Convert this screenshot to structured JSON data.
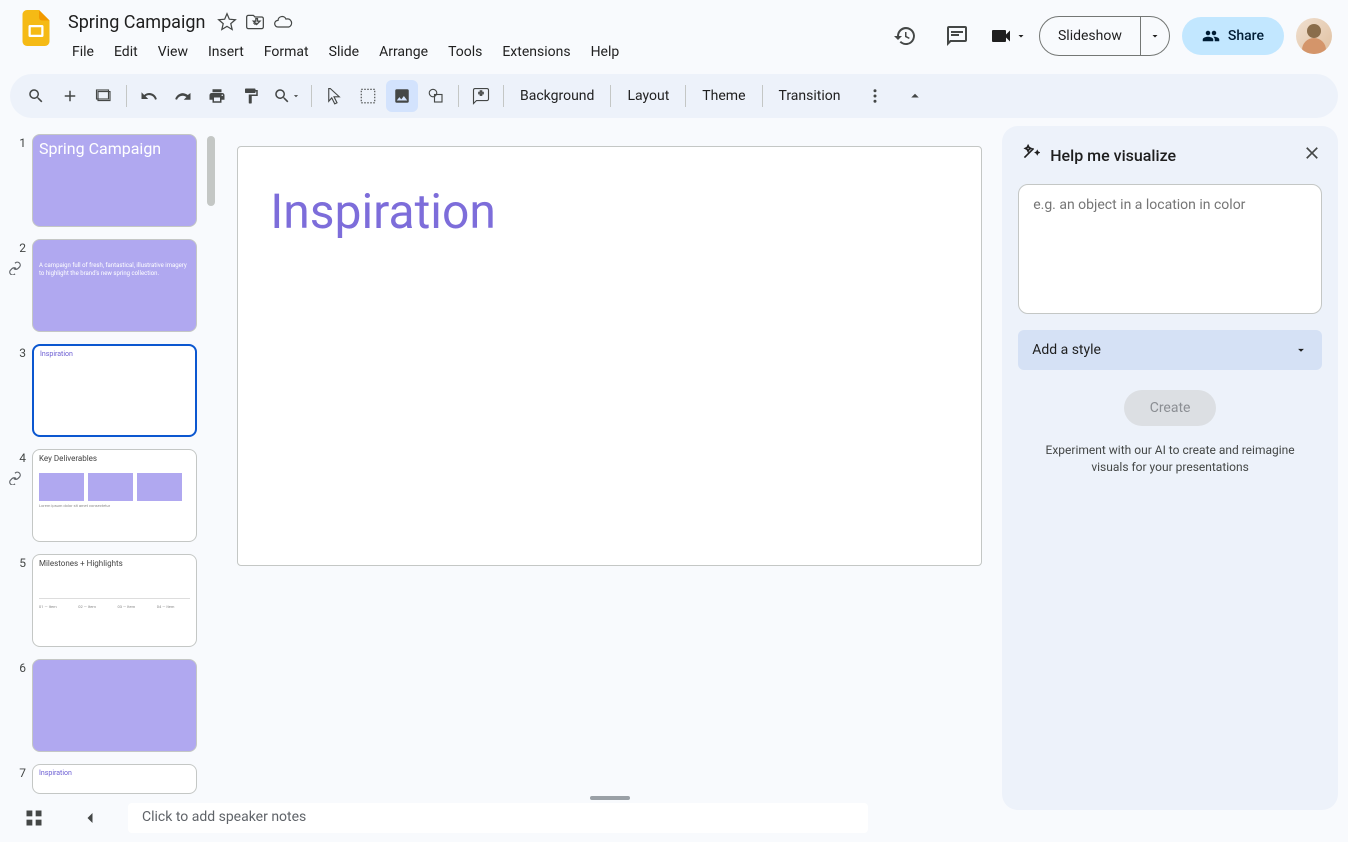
{
  "document": {
    "title": "Spring Campaign"
  },
  "menu": [
    "File",
    "Edit",
    "View",
    "Insert",
    "Format",
    "Slide",
    "Arrange",
    "Tools",
    "Extensions",
    "Help"
  ],
  "header": {
    "slideshow": "Slideshow",
    "share": "Share"
  },
  "toolbar": {
    "background": "Background",
    "layout": "Layout",
    "theme": "Theme",
    "transition": "Transition"
  },
  "slides": [
    {
      "num": "1",
      "type": "purple",
      "title": "Spring Campaign",
      "body": ""
    },
    {
      "num": "2",
      "type": "purple",
      "title": "",
      "body": "A campaign full of fresh, fantastical, illustrative imagery to highlight the brand's new spring collection.",
      "linked": true
    },
    {
      "num": "3",
      "type": "white",
      "title": "Inspiration",
      "selected": true
    },
    {
      "num": "4",
      "type": "deliverables",
      "title": "Key Deliverables",
      "linked": true
    },
    {
      "num": "5",
      "type": "milestones",
      "title": "Milestones + Highlights"
    },
    {
      "num": "6",
      "type": "purple",
      "title": "",
      "body": ""
    },
    {
      "num": "7",
      "type": "white",
      "title": "Inspiration"
    }
  ],
  "canvas": {
    "title": "Inspiration"
  },
  "notes": {
    "placeholder": "Click to add speaker notes"
  },
  "rightPanel": {
    "title": "Help me visualize",
    "placeholder": "e.g. an object in a location in color",
    "styleLabel": "Add a style",
    "createLabel": "Create",
    "hint": "Experiment with our AI to create and reimagine visuals for your presentations"
  }
}
